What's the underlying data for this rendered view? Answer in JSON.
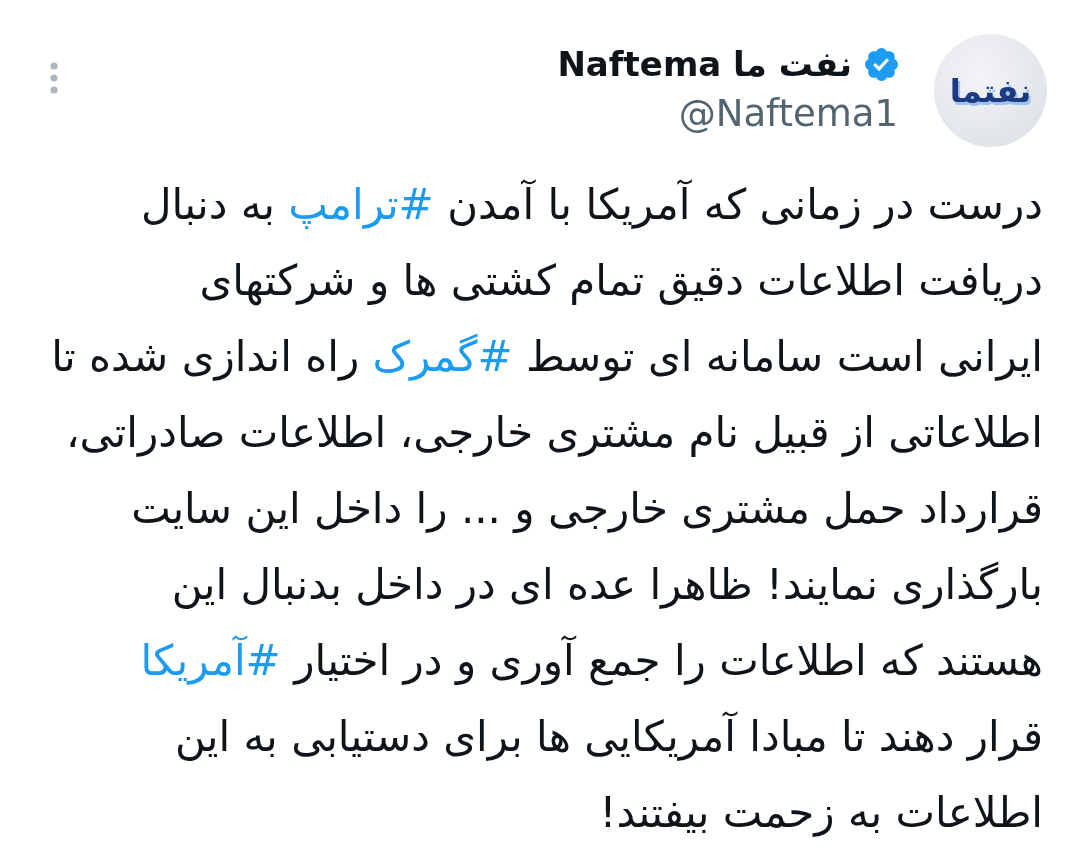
{
  "tweet": {
    "author": {
      "display_name": "نفت ما Naftema",
      "verified": true,
      "handle": "@Naftema1",
      "avatar": {
        "logo_text": "نفتما"
      }
    },
    "body": {
      "lines": [
        [
          {
            "kind": "text",
            "text": "درست در زمانی که آمریکا با آمدن "
          },
          {
            "kind": "hashtag",
            "text": "#ترامپ"
          },
          {
            "kind": "text",
            "text": " به دنبال"
          }
        ],
        [
          {
            "kind": "text",
            "text": "دریافت اطلاعات دقیق تمام کشتی ها و شرکتهای"
          }
        ],
        [
          {
            "kind": "text",
            "text": "ایرانی است سامانه ای توسط "
          },
          {
            "kind": "hashtag",
            "text": "#گمرک"
          },
          {
            "kind": "text",
            "text": " راه اندازی شده تا"
          }
        ],
        [
          {
            "kind": "text",
            "text": "اطلاعاتی از قبیل نام مشتری خارجی، اطلاعات صادراتی،"
          }
        ],
        [
          {
            "kind": "text",
            "text": "قرارداد حمل مشتری خارجی و ... را داخل این سایت"
          }
        ],
        [
          {
            "kind": "text",
            "text": "بارگذاری نمایند! ظاهرا عده ای در داخل بدنبال این"
          }
        ],
        [
          {
            "kind": "text",
            "text": "هستند که اطلاعات را جمع آوری و در اختیار "
          },
          {
            "kind": "hashtag",
            "text": "#آمریکا"
          }
        ],
        [
          {
            "kind": "text",
            "text": "قرار دهند تا مبادا آمریکایی ها برای دستیابی به این"
          }
        ],
        [
          {
            "kind": "text",
            "text": "اطلاعات به زحمت بیفتند!"
          }
        ]
      ]
    }
  }
}
